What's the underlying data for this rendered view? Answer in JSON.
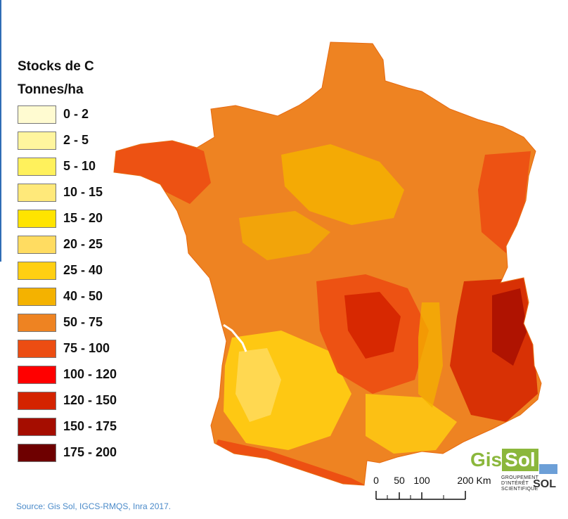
{
  "legend": {
    "title": "Stocks de C",
    "unit": "Tonnes/ha",
    "items": [
      {
        "label": "0 - 2",
        "color": "#fffbd1"
      },
      {
        "label": "2 - 5",
        "color": "#fff59e"
      },
      {
        "label": "5 - 10",
        "color": "#fff15c"
      },
      {
        "label": "10 - 15",
        "color": "#ffe97a"
      },
      {
        "label": "15 - 20",
        "color": "#ffe400"
      },
      {
        "label": "20 - 25",
        "color": "#ffdc61"
      },
      {
        "label": "25 - 40",
        "color": "#ffcf12"
      },
      {
        "label": "40 - 50",
        "color": "#f4b200"
      },
      {
        "label": "50 - 75",
        "color": "#ee8322"
      },
      {
        "label": "75 - 100",
        "color": "#ec4d12"
      },
      {
        "label": "100 - 120",
        "color": "#ff0000"
      },
      {
        "label": "120 - 150",
        "color": "#d42300"
      },
      {
        "label": "150 - 175",
        "color": "#a50d00"
      },
      {
        "label": "175 - 200",
        "color": "#6e0000"
      }
    ]
  },
  "scale_bar": {
    "ticks": [
      "0",
      "50",
      "100",
      "200"
    ],
    "unit": "Km"
  },
  "logo": {
    "gis": "Gis",
    "sol": "Sol",
    "subtitle_lines": [
      "GROUPEMENT",
      "D'INTÉRÊT",
      "SCIENTIFIQUE"
    ],
    "subtitle_word": "SOL"
  },
  "source": "Source: Gis Sol, IGCS-RMQS, Inra 2017.",
  "colors": {
    "base": "#ee8322",
    "low": "#ffcf12",
    "high": "#ec4d12",
    "very_high": "#d42300",
    "accent": "#2f6db5"
  }
}
